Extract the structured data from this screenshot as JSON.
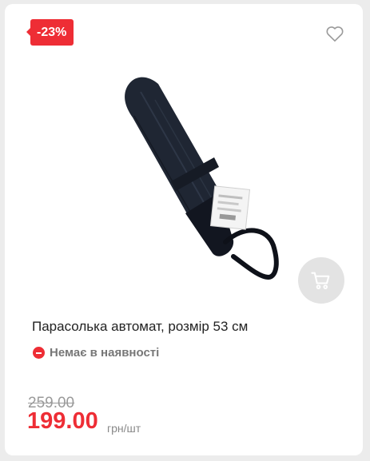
{
  "product": {
    "discount_badge": "-23%",
    "title": "Парасолька автомат, розмір 53 см",
    "stock_status": "Немає в наявності",
    "old_price": "259.00",
    "current_price": "199.00",
    "price_unit": "грн/шт"
  },
  "icons": {
    "favorite": "heart-outline-icon",
    "cart": "shopping-cart-icon",
    "stock": "minus-circle-icon"
  },
  "colors": {
    "accent": "#ee2d35",
    "cart_button_bg": "#e3e3e3",
    "muted_text": "#777777"
  }
}
